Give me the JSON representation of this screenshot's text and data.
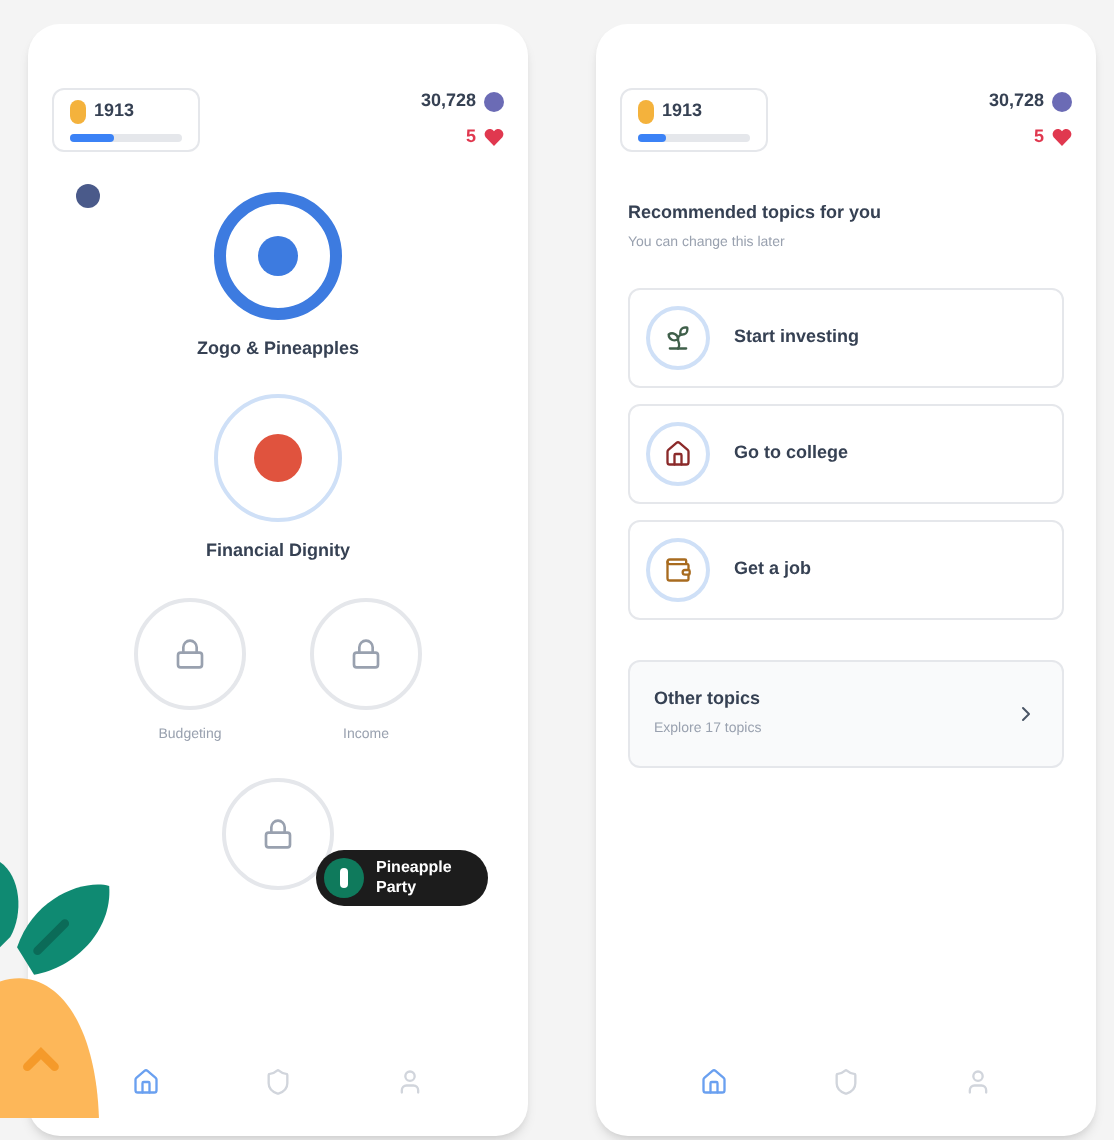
{
  "screens": [
    {
      "kind": "path",
      "header": {
        "score": "1913",
        "level": 0.4,
        "coins": "30,728",
        "hearts": "5"
      },
      "path_nodes": [
        {
          "label": "Zogo & Pineapples",
          "kind": "current"
        },
        {
          "label": "Financial Dignity",
          "kind": "open"
        },
        {
          "label": "Budgeting",
          "kind": "locked"
        },
        {
          "label": "Income",
          "kind": "locked"
        },
        {
          "kind": "locked"
        }
      ],
      "party_button": "Pineapple Party",
      "nav": [
        {
          "selected": true
        },
        {
          "selected": false
        },
        {
          "selected": false
        }
      ]
    },
    {
      "kind": "topics",
      "header": {
        "score": "1913",
        "level": 0.25,
        "coins": "30,728",
        "hearts": "5"
      },
      "title": "Recommended topics for you",
      "subtitle": "You can change this later",
      "topics": [
        {
          "label": "Start investing"
        },
        {
          "label": "Go to college"
        },
        {
          "label": "Get a job"
        }
      ],
      "other": {
        "title": "Other topics",
        "subtitle": "Explore 17 topics"
      },
      "nav": [
        {
          "selected": true
        },
        {
          "selected": false
        },
        {
          "selected": false
        }
      ]
    }
  ]
}
